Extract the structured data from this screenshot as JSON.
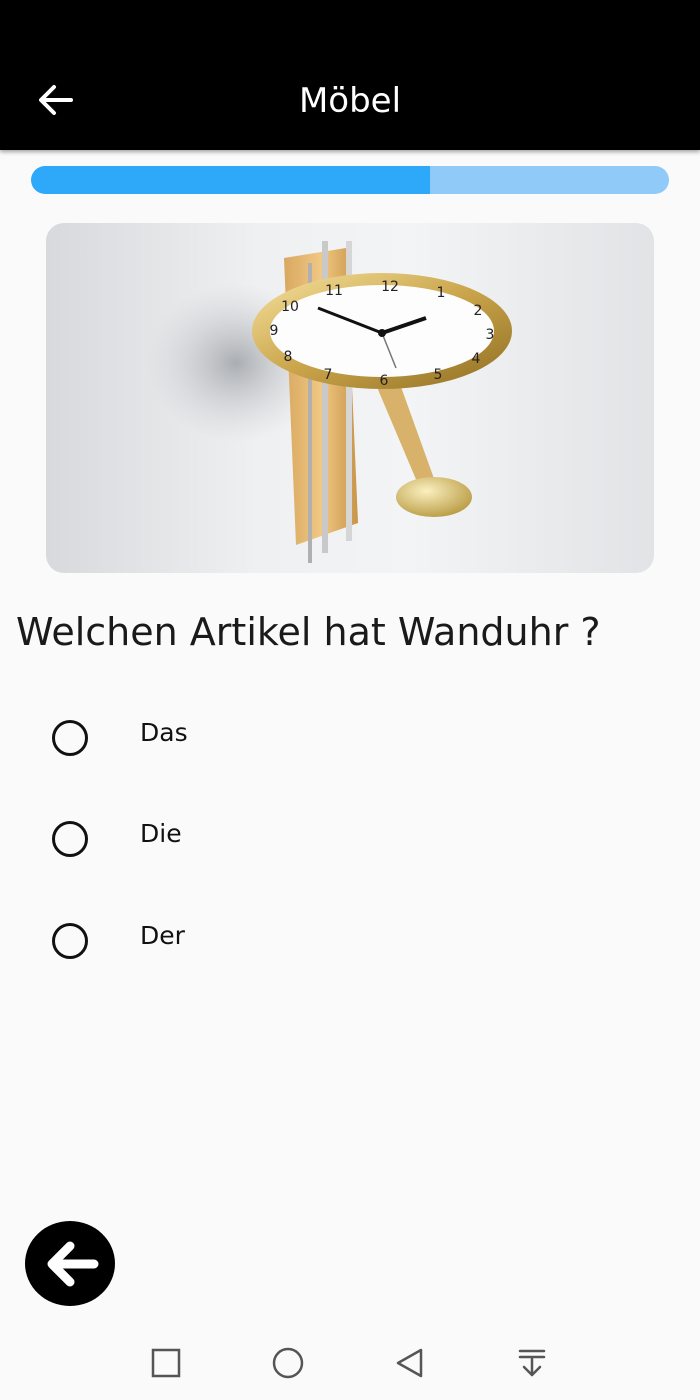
{
  "app_bar": {
    "title": "Möbel",
    "back_icon": "arrow-left-icon",
    "background": "#000000",
    "title_color": "#ffffff"
  },
  "progress": {
    "value": 0.625,
    "fill_color": "#2ea8f8",
    "track_color": "#90caf9"
  },
  "question": {
    "text": "Welchen Artikel hat Wanduhr ?"
  },
  "options": [
    {
      "label": "Das",
      "selected": false
    },
    {
      "label": "Die",
      "selected": false
    },
    {
      "label": "Der",
      "selected": false
    }
  ],
  "image": {
    "clock_numbers": [
      "12",
      "1",
      "2",
      "3",
      "4",
      "5",
      "6",
      "7",
      "8",
      "9",
      "10",
      "11"
    ]
  },
  "fab": {
    "icon": "arrow-left-icon"
  },
  "system_nav": {
    "icons": [
      "recent-apps-icon",
      "home-icon",
      "back-triangle-icon",
      "notification-pull-icon"
    ]
  }
}
